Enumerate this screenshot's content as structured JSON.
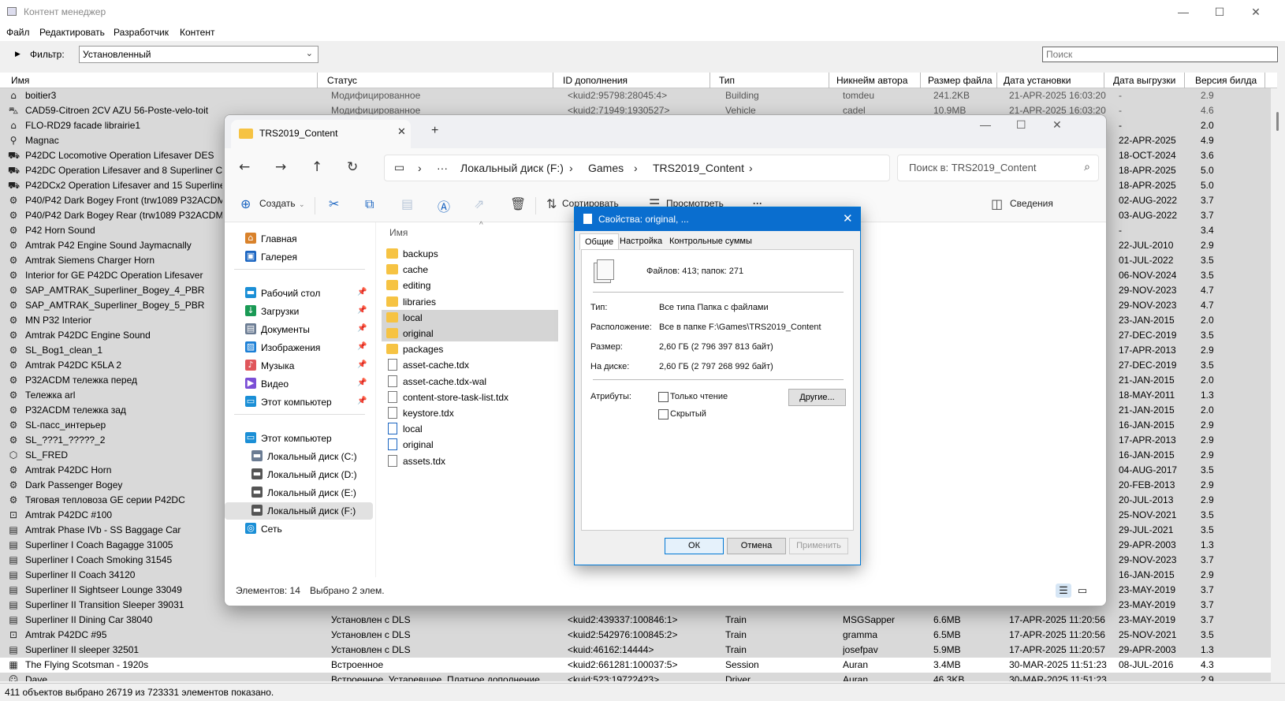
{
  "cm": {
    "title": "Контент менеджер",
    "win_controls": {
      "minimize": "—",
      "maximize": "☐",
      "close": "✕"
    },
    "menu": [
      "Файл",
      "Редактировать",
      "Разработчик",
      "Контент"
    ],
    "filter": {
      "label": "Фильтр:",
      "value": "Установленный"
    },
    "search": {
      "placeholder": "Поиск"
    },
    "columns": [
      "Имя",
      "Статус",
      "ID дополнения",
      "Тип",
      "Никнейм автора",
      "Размер файла",
      "Дата установки",
      "Дата выгрузки",
      "Версия билда"
    ],
    "rows": [
      {
        "icon": "house-icon",
        "name": "boitier3",
        "status": "Модифицированное",
        "id": "<kuid2:95798:28045:4>",
        "type": "Building",
        "author": "tomdeu",
        "size": "241.2KB",
        "installed": "21-APR-2025 16:03:20",
        "uploaded": "-",
        "build": "2.9"
      },
      {
        "icon": "car-icon",
        "name": "CAD59-Citroen 2CV AZU 56-Poste-velo-toit",
        "status": "Модифицированное",
        "id": "<kuid2:71949:1930527>",
        "type": "Vehicle",
        "author": "cadel",
        "size": "10.9MB",
        "installed": "21-APR-2025 16:03:20",
        "uploaded": "-",
        "build": "4.6"
      },
      {
        "icon": "house-icon",
        "name": "FLO-RD29 facade librairie1",
        "uploaded": "-",
        "build": "2.0"
      },
      {
        "icon": "pin-icon",
        "name": "Magnac",
        "uploaded": "22-APR-2025",
        "build": "4.9"
      },
      {
        "icon": "loco-icon",
        "name": "P42DC Locomotive Operation Lifesaver DES",
        "uploaded": "18-OCT-2024",
        "build": "3.6"
      },
      {
        "icon": "loco-icon",
        "name": "P42DC Operation Lifesaver and 8 Superliner Cars",
        "uploaded": "18-APR-2025",
        "build": "5.0"
      },
      {
        "icon": "loco-icon",
        "name": "P42DCx2 Operation Lifesaver and 15 Superliner C",
        "uploaded": "18-APR-2025",
        "build": "5.0"
      },
      {
        "icon": "bogey-icon",
        "name": "P40/P42 Dark Bogey Front (trw1089 P32ACDM) (",
        "uploaded": "02-AUG-2022",
        "build": "3.7"
      },
      {
        "icon": "bogey-icon",
        "name": "P40/P42 Dark Bogey Rear (trw1089 P32ACDM) (f",
        "uploaded": "03-AUG-2022",
        "build": "3.7"
      },
      {
        "icon": "bogey-icon",
        "name": "P42 Horn Sound",
        "uploaded": "-",
        "build": "3.4"
      },
      {
        "icon": "bogey-icon",
        "name": "Amtrak P42 Engine Sound Jaymacnally",
        "uploaded": "22-JUL-2010",
        "build": "2.9"
      },
      {
        "icon": "bogey-icon",
        "name": "Amtrak Siemens Charger Horn",
        "uploaded": "01-JUL-2022",
        "build": "3.5"
      },
      {
        "icon": "bogey-icon",
        "name": "Interior for GE P42DC Operation Lifesaver",
        "uploaded": "06-NOV-2024",
        "build": "3.5"
      },
      {
        "icon": "bogey-icon",
        "name": "SAP_AMTRAK_Superliner_Bogey_4_PBR",
        "uploaded": "29-NOV-2023",
        "build": "4.7"
      },
      {
        "icon": "bogey-icon",
        "name": "SAP_AMTRAK_Superliner_Bogey_5_PBR",
        "uploaded": "29-NOV-2023",
        "build": "4.7"
      },
      {
        "icon": "bogey-icon",
        "name": "MN P32 Interior",
        "uploaded": "23-JAN-2015",
        "build": "2.0"
      },
      {
        "icon": "bogey-icon",
        "name": "Amtrak P42DC Engine Sound",
        "uploaded": "27-DEC-2019",
        "build": "3.5"
      },
      {
        "icon": "bogey-icon",
        "name": "SL_Bog1_clean_1",
        "uploaded": "17-APR-2013",
        "build": "2.9"
      },
      {
        "icon": "bogey-icon",
        "name": "Amtrak P42DC K5LA 2",
        "uploaded": "27-DEC-2019",
        "build": "3.5"
      },
      {
        "icon": "bogey-icon",
        "name": "P32ACDM тележка перед",
        "uploaded": "21-JAN-2015",
        "build": "2.0"
      },
      {
        "icon": "bogey-icon",
        "name": "Тележка arl",
        "uploaded": "18-MAY-2011",
        "build": "1.3"
      },
      {
        "icon": "bogey-icon",
        "name": "P32ACDM тележка зад",
        "uploaded": "21-JAN-2015",
        "build": "2.0"
      },
      {
        "icon": "bogey-icon",
        "name": "SL-пасс_интерьер",
        "uploaded": "16-JAN-2015",
        "build": "2.9"
      },
      {
        "icon": "bogey-icon",
        "name": "SL_???1_?????_2",
        "uploaded": "17-APR-2013",
        "build": "2.9"
      },
      {
        "icon": "cube-icon",
        "name": "SL_FRED",
        "uploaded": "16-JAN-2015",
        "build": "2.9"
      },
      {
        "icon": "bogey-icon",
        "name": "Amtrak P42DC Horn",
        "uploaded": "04-AUG-2017",
        "build": "3.5"
      },
      {
        "icon": "bogey-icon",
        "name": "Dark Passenger Bogey",
        "uploaded": "20-FEB-2013",
        "build": "2.9"
      },
      {
        "icon": "bogey-icon",
        "name": "Тяговая тепловоза GE серии P42DC",
        "uploaded": "20-JUL-2013",
        "build": "2.9"
      },
      {
        "icon": "train-icon",
        "name": "Amtrak P42DC #100",
        "uploaded": "25-NOV-2021",
        "build": "3.5"
      },
      {
        "icon": "coach-icon",
        "name": "Amtrak Phase IVb - SS Baggage Car",
        "uploaded": "29-JUL-2021",
        "build": "3.5"
      },
      {
        "icon": "coach-icon",
        "name": "Superliner I Coach Bagagge 31005",
        "uploaded": "29-APR-2003",
        "build": "1.3"
      },
      {
        "icon": "coach-icon",
        "name": "Superliner I Coach Smoking 31545",
        "uploaded": "29-NOV-2023",
        "build": "3.7"
      },
      {
        "icon": "coach-icon",
        "name": "Superliner II Coach 34120",
        "uploaded": "16-JAN-2015",
        "build": "2.9"
      },
      {
        "icon": "coach-icon",
        "name": "Superliner II Sightseer Lounge 33049",
        "uploaded": "23-MAY-2019",
        "build": "3.7"
      },
      {
        "icon": "coach-icon",
        "name": "Superliner II Transition Sleeper 39031",
        "uploaded": "23-MAY-2019",
        "build": "3.7"
      },
      {
        "icon": "coach-icon",
        "name": "Superliner II Dining Car 38040",
        "status": "Установлен с DLS",
        "id": "<kuid2:439337:100846:1>",
        "type": "Train",
        "author": "MSGSapper",
        "size": "6.6MB",
        "installed": "17-APR-2025 11:20:56",
        "uploaded": "23-MAY-2019",
        "build": "3.7"
      },
      {
        "icon": "train-icon",
        "name": "Amtrak P42DC #95",
        "status": "Установлен с DLS",
        "id": "<kuid2:542976:100845:2>",
        "type": "Train",
        "author": "gramma",
        "size": "6.5MB",
        "installed": "17-APR-2025 11:20:56",
        "uploaded": "25-NOV-2021",
        "build": "3.5"
      },
      {
        "icon": "coach-icon",
        "name": "Superliner II sleeper 32501",
        "status": "Установлен с DLS",
        "id": "<kuid:46162:14444>",
        "type": "Train",
        "author": "josefpav",
        "size": "5.9MB",
        "installed": "17-APR-2025 11:20:57",
        "uploaded": "29-APR-2003",
        "build": "1.3"
      },
      {
        "icon": "session-icon",
        "name": "The Flying Scotsman - 1920s",
        "status": "Встроенное",
        "id": "<kuid2:661281:100037:5>",
        "type": "Session",
        "author": "Auran",
        "size": "3.4MB",
        "installed": "30-MAR-2025 11:51:23",
        "uploaded": "08-JUL-2016",
        "build": "4.3"
      },
      {
        "icon": "driver-icon",
        "name": "Dave",
        "status": "Встроенное, Устаревшее, Платное дополнение",
        "id": "<kuid:523:19722423>",
        "type": "Driver",
        "author": "Auran",
        "size": "46.3KB",
        "installed": "30-MAR-2025 11:51:23",
        "uploaded": "",
        "build": "2.9"
      }
    ],
    "status": "411 объектов выбрано 26719 из 723331 элементов показано."
  },
  "explorer": {
    "tab_title": "TRS2019_Content",
    "tab_close": "✕",
    "new_tab": "+",
    "win_controls": {
      "minimize": "—",
      "maximize": "☐",
      "close": "✕"
    },
    "breadcrumb": [
      "Локальный диск (F:)",
      "Games",
      "TRS2019_Content"
    ],
    "breadcrumb_more": "···",
    "search_placeholder": "Поиск в: TRS2019_Content",
    "commands": {
      "create": "Создать",
      "sort": "Сортировать",
      "view": "Просмотреть",
      "more": "···",
      "details": "Сведения"
    },
    "nav": [
      {
        "name": "nav-home",
        "icon": "home-icon",
        "label": "Главная",
        "color": "#d9822b"
      },
      {
        "name": "nav-gallery",
        "icon": "gallery-icon",
        "label": "Галерея",
        "color": "#1b65c1"
      },
      {
        "name": "nav-desktop",
        "icon": "desktop-icon",
        "label": "Рабочий стол",
        "color": "#1b8fd6",
        "pinned": true
      },
      {
        "name": "nav-downloads",
        "icon": "download-icon",
        "label": "Загрузки",
        "color": "#1a9a55",
        "pinned": true
      },
      {
        "name": "nav-documents",
        "icon": "document-icon",
        "label": "Документы",
        "color": "#6b7c93",
        "pinned": true
      },
      {
        "name": "nav-pictures",
        "icon": "pictures-icon",
        "label": "Изображения",
        "color": "#1b7fd6",
        "pinned": true
      },
      {
        "name": "nav-music",
        "icon": "music-icon",
        "label": "Музыка",
        "color": "#e0565b",
        "pinned": true
      },
      {
        "name": "nav-video",
        "icon": "video-icon",
        "label": "Видео",
        "color": "#7b4fd6",
        "pinned": true
      },
      {
        "name": "nav-this-pc-pinned",
        "icon": "computer-icon",
        "label": "Этот компьютер",
        "color": "#1b8fd6",
        "pinned": true
      },
      {
        "name": "nav-this-pc",
        "icon": "computer-icon",
        "label": "Этот компьютер",
        "color": "#1b8fd6"
      },
      {
        "name": "nav-drive-c",
        "icon": "drive-icon",
        "label": "Локальный диск (C:)",
        "color": "#6b7c93"
      },
      {
        "name": "nav-drive-d",
        "icon": "drive-icon",
        "label": "Локальный диск (D:)",
        "color": "#555555"
      },
      {
        "name": "nav-drive-e",
        "icon": "drive-icon",
        "label": "Локальный диск (E:)",
        "color": "#555555"
      },
      {
        "name": "nav-drive-f",
        "icon": "drive-icon",
        "label": "Локальный диск (F:)",
        "color": "#555555",
        "selected": true
      },
      {
        "name": "nav-network",
        "icon": "network-icon",
        "label": "Сеть",
        "color": "#1b8fd6"
      }
    ],
    "column_name": "Имя",
    "files": [
      {
        "kind": "folder",
        "name": "backups"
      },
      {
        "kind": "folder",
        "name": "cache"
      },
      {
        "kind": "folder",
        "name": "editing"
      },
      {
        "kind": "folder",
        "name": "libraries"
      },
      {
        "kind": "folder",
        "name": "local",
        "selected": true
      },
      {
        "kind": "folder",
        "name": "original",
        "selected": true
      },
      {
        "kind": "folder",
        "name": "packages"
      },
      {
        "kind": "doc",
        "name": "asset-cache.tdx"
      },
      {
        "kind": "doc",
        "name": "asset-cache.tdx-wal"
      },
      {
        "kind": "doc",
        "name": "content-store-task-list.tdx"
      },
      {
        "kind": "doc",
        "name": "keystore.tdx"
      },
      {
        "kind": "lnk",
        "name": "local"
      },
      {
        "kind": "lnk",
        "name": "original"
      },
      {
        "kind": "doc",
        "name": "assets.tdx"
      }
    ],
    "status_items": "Элементов: 14",
    "status_selected": "Выбрано 2 элем."
  },
  "dialog": {
    "title": "Свойства: original, ...",
    "close": "✕",
    "tabs": [
      "Общие",
      "Настройка",
      "Контрольные суммы"
    ],
    "summary": "Файлов: 413; папок: 271",
    "fields": [
      {
        "label": "Тип:",
        "value": "Все типа Папка с файлами"
      },
      {
        "label": "Расположение:",
        "value": "Все в папке F:\\Games\\TRS2019_Content"
      },
      {
        "label": "Размер:",
        "value": "2,60 ГБ (2 796 397 813 байт)"
      },
      {
        "label": "На диске:",
        "value": "2,60 ГБ (2 797 268 992 байт)"
      }
    ],
    "attributes_label": "Атрибуты:",
    "readonly_label": "Только чтение",
    "hidden_label": "Скрытый",
    "other_button": "Другие...",
    "buttons": {
      "ok": "ОК",
      "cancel": "Отмена",
      "apply": "Применить"
    },
    "accent": "#0a6ecf"
  }
}
